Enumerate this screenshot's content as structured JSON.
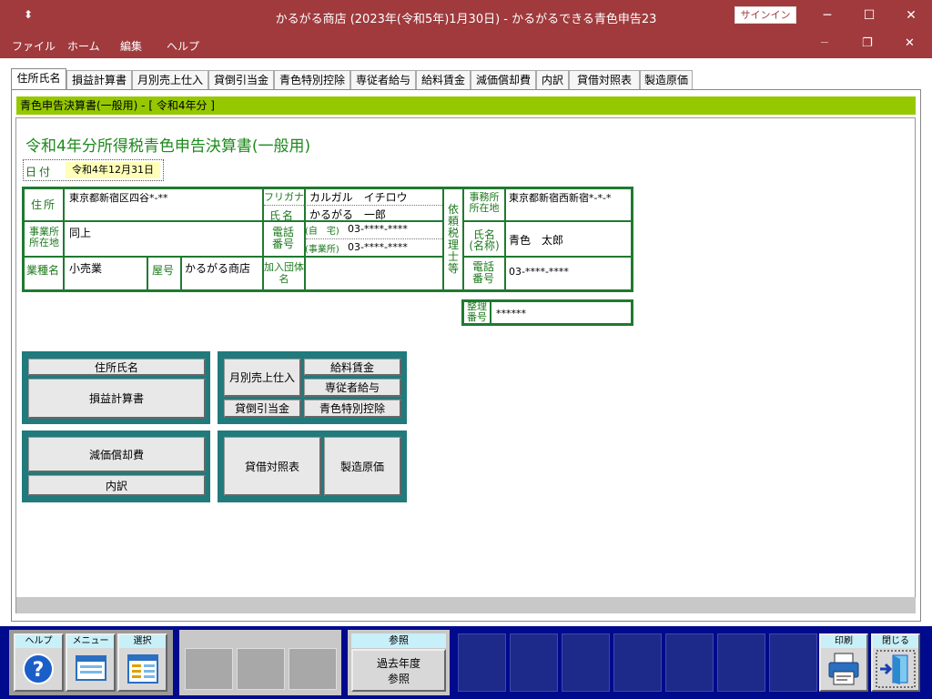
{
  "window": {
    "title": "かるがる商店 (2023年(令和5年)1月30日)  -  かるがるできる青色申告23",
    "signin": "サインイン",
    "dropdown": "⬍"
  },
  "menu": {
    "file": "ファイル",
    "home": "ホーム",
    "edit": "編集",
    "help": "ヘルプ"
  },
  "tabs": [
    "住所氏名",
    "損益計算書",
    "月別売上仕入",
    "貸倒引当金",
    "青色特別控除",
    "専従者給与",
    "給料賃金",
    "減価償却費",
    "内訳",
    "貸借対照表",
    "製造原価"
  ],
  "breadcrumb": "青色申告決算書(一般用) - [ 令和4年分 ]",
  "doc": {
    "title": "令和4年分所得税青色申告決算書(一般用)",
    "date_label": "日付",
    "date_value": "令和4年12月31日"
  },
  "form": {
    "address_label": "住所",
    "address_value": "東京都新宿区四谷*-**",
    "furigana_label": "フリガナ",
    "furigana_value": "カルガル　イチロウ",
    "name_label": "氏名",
    "name_value": "かるがる　一郎",
    "office_label": "事業所所在地",
    "office_value": "同上",
    "phone_label": "電話番号",
    "phone_home_label": "(自　宅)",
    "phone_home_value": "03-****-****",
    "phone_office_label": "(事業所)",
    "phone_office_value": "03-****-****",
    "industry_label": "業種名",
    "industry_value": "小売業",
    "shop_label": "屋号",
    "shop_value": "かるがる商店",
    "org_label": "加入団体名",
    "org_value": "",
    "agent_label": "依頼税理士等",
    "agent_office_label": "事務所所在地",
    "agent_office_value": "東京都新宿西新宿*-*-*",
    "agent_name_label": "氏名(名称)",
    "agent_name_value": "青色　太郎",
    "agent_phone_label": "電話番号",
    "agent_phone_value": "03-****-****",
    "ref_label": "整理番号",
    "ref_value": "******"
  },
  "nav": {
    "jusho": "住所氏名",
    "sonek": "損益計算書",
    "getsu": "月別売上仕入",
    "kyuryo": "給料賃金",
    "senju": "専従者給与",
    "kashi": "貸倒引当金",
    "aoiro": "青色特別控除",
    "genka": "減価償却費",
    "uchi": "内訳",
    "taisha": "貸借対照表",
    "seizo": "製造原価"
  },
  "bottom": {
    "help": "ヘルプ",
    "menu": "メニュー",
    "select": "選択",
    "ref_cap": "参照",
    "ref_btn": "過去年度参照",
    "print": "印刷",
    "close": "閉じる"
  }
}
